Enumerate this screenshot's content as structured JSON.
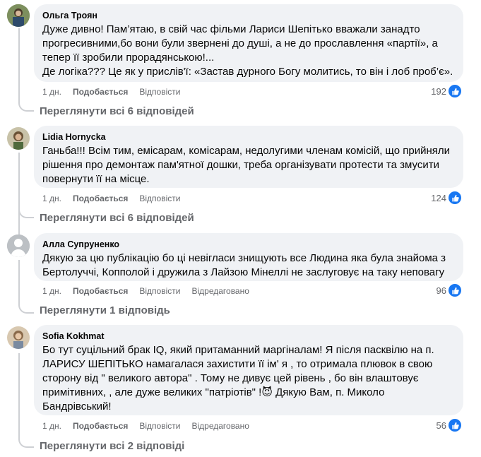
{
  "comments": [
    {
      "author": "Ольга Троян",
      "text": "Дуже дивно! Пам’ятаю, в свій час фільми Лариси Шепітько вважали занадто\nпрогресивними,бо вони були звернені до душі, а не до прославлення «партії», а\nтепер її зробили прорадянською!...\nДе логіка??? Це як у прислів'ї: «Застав дурного Богу молитись, то він і лоб проб’є».",
      "time": "1 дн.",
      "like_label": "Подобається",
      "reply_label": "Відповісти",
      "edited_label": "",
      "react_count": "192",
      "view_replies": "Переглянути всі 6 відповідей"
    },
    {
      "author": "Lidia Hornycka",
      "text": "Ганьба!!! Всім тим, емісарам, комісарам, недолугими членам комісій, що прийняли\nрішення про демонтаж пам'ятної дошки, треба організувати протести та змусити\nповернути її на місце.",
      "time": "1 дн.",
      "like_label": "Подобається",
      "reply_label": "Відповісти",
      "edited_label": "",
      "react_count": "124",
      "view_replies": "Переглянути всі 6 відповідей"
    },
    {
      "author": "Алла Супруненко",
      "text": "Дякую за цю публікацію бо ці невігласи знищують все Людина яка була знайома з\nБертолуччі, Копполой і дружила з Лайзою Мінеллі не заслуговує на таку неповагу",
      "time": "1 дн.",
      "like_label": "Подобається",
      "reply_label": "Відповісти",
      "edited_label": "Відредаговано",
      "react_count": "96",
      "view_replies": "Переглянути 1 відповідь"
    },
    {
      "author": "Sofia Kokhmat",
      "text": "Бо тут суцільний брак IQ, який притаманний маргіналам! Я після пасквілю на п.\nЛАРИСУ ШЕПІТЬКО намагалася захистити її ім' я , то отримала плювок в свою\nсторону від \" великого автора\" . Тому не дивує цей рівень , бо він влаштовує\nпримітивних, , але дуже великих \"патріотів\" !😈 Дякую Вам, п. Миколо\nБандрівський!",
      "time": "1 дн.",
      "like_label": "Подобається",
      "reply_label": "Відповісти",
      "edited_label": "Відредаговано",
      "react_count": "56",
      "view_replies": "Переглянути всі 2 відповіді"
    }
  ],
  "icons": {
    "like": "thumbs-up-icon",
    "avatar_default": "user-silhouette-icon"
  },
  "colors": {
    "like_blue": "#1877f2",
    "bubble": "#f0f2f5",
    "muted": "#65676b"
  }
}
